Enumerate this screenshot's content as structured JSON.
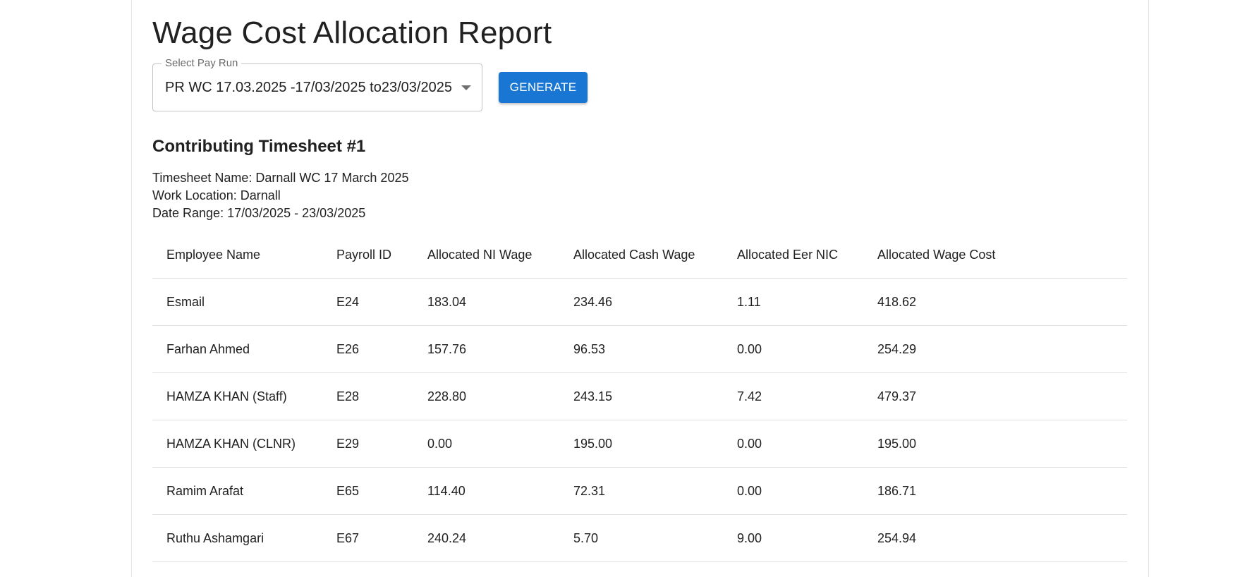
{
  "page": {
    "title": "Wage Cost Allocation Report"
  },
  "controls": {
    "pay_run_label": "Select Pay Run",
    "pay_run_value": "PR WC 17.03.2025 -17/03/2025 to23/03/2025",
    "generate_label": "GENERATE"
  },
  "timesheet": {
    "heading": "Contributing Timesheet #1",
    "name_line": "Timesheet Name: Darnall WC 17 March 2025",
    "location_line": "Work Location: Darnall",
    "date_line": "Date Range: 17/03/2025 - 23/03/2025"
  },
  "table": {
    "headers": [
      "Employee Name",
      "Payroll ID",
      "Allocated NI Wage",
      "Allocated Cash Wage",
      "Allocated Eer NIC",
      "Allocated Wage Cost"
    ],
    "rows": [
      [
        "Esmail",
        "E24",
        "183.04",
        "234.46",
        "1.11",
        "418.62"
      ],
      [
        "Farhan Ahmed",
        "E26",
        "157.76",
        "96.53",
        "0.00",
        "254.29"
      ],
      [
        "HAMZA KHAN (Staff)",
        "E28",
        "228.80",
        "243.15",
        "7.42",
        "479.37"
      ],
      [
        "HAMZA KHAN (CLNR)",
        "E29",
        "0.00",
        "195.00",
        "0.00",
        "195.00"
      ],
      [
        "Ramim Arafat",
        "E65",
        "114.40",
        "72.31",
        "0.00",
        "186.71"
      ],
      [
        "Ruthu Ashamgari",
        "E67",
        "240.24",
        "5.70",
        "9.00",
        "254.94"
      ]
    ]
  },
  "colors": {
    "primary": "#1976d2",
    "text": "#212121",
    "divider": "#e0e0e0"
  }
}
